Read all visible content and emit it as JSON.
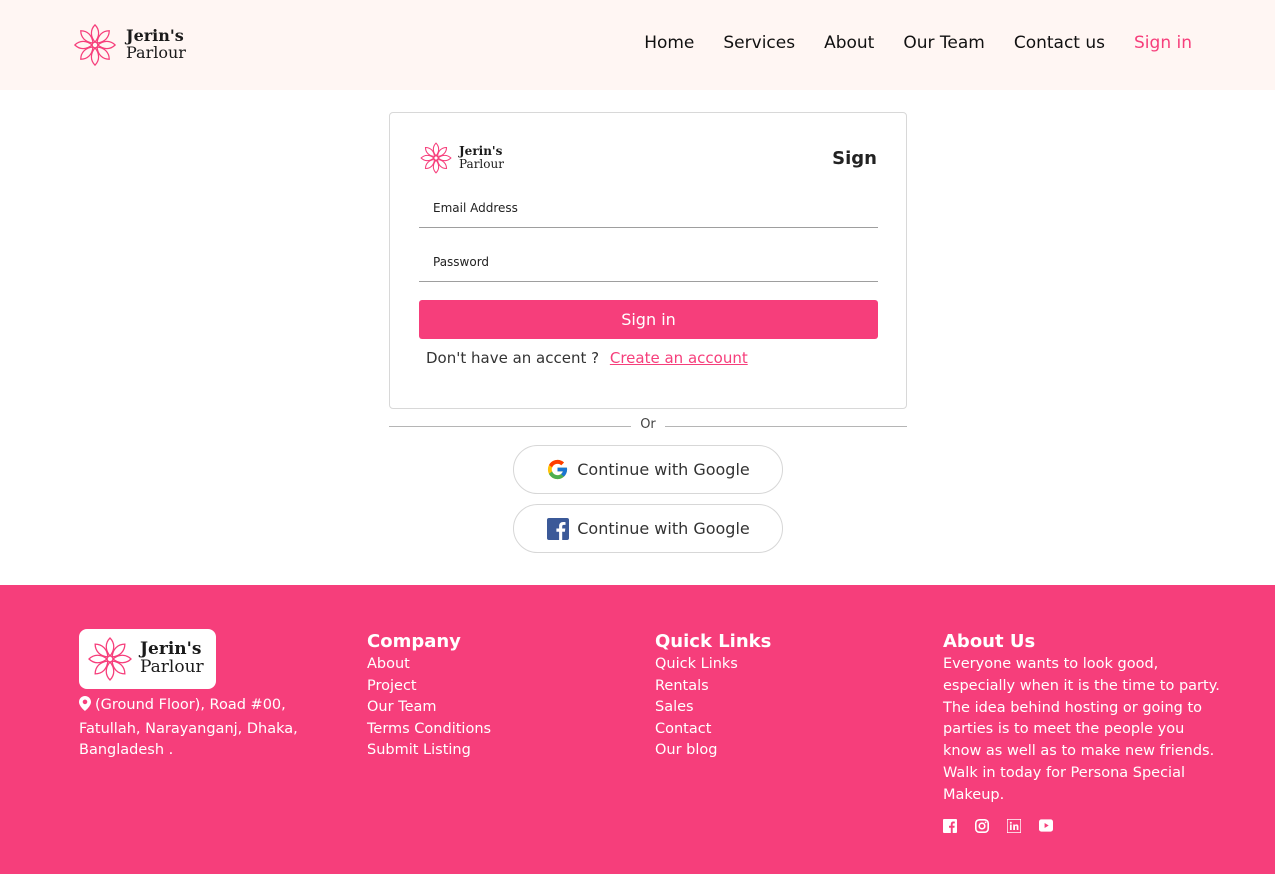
{
  "brand": {
    "name_line1": "Jerin's",
    "name_line2": "Parlour",
    "accent_color": "#f63e7b",
    "logo_icon": "lotus-flower-icon"
  },
  "nav": {
    "items": [
      {
        "label": "Home"
      },
      {
        "label": "Services"
      },
      {
        "label": "About"
      },
      {
        "label": "Our Team"
      },
      {
        "label": "Contact us"
      },
      {
        "label": "Sign in",
        "active": true
      }
    ]
  },
  "signin_card": {
    "title": "Sign",
    "email_placeholder": "Email Address",
    "password_placeholder": "Password",
    "button_label": "Sign in",
    "no_account_text": "Don't have an accent ?",
    "create_account_link": "Create an account"
  },
  "separator": {
    "label": "Or"
  },
  "social_buttons": [
    {
      "icon": "google-icon",
      "label": "Continue with Google"
    },
    {
      "icon": "facebook-icon",
      "label": "Continue with Google"
    }
  ],
  "footer": {
    "address_icon": "location-pin-icon",
    "address": "(Ground Floor), Road #00, Fatullah, Narayanganj, Dhaka, Bangladesh .",
    "company": {
      "heading": "Company",
      "links": [
        "About",
        "Project",
        "Our Team",
        "Terms Conditions",
        "Submit Listing"
      ]
    },
    "quick_links": {
      "heading": "Quick Links",
      "links": [
        "Quick Links",
        "Rentals",
        "Sales",
        "Contact",
        "Our blog"
      ]
    },
    "about_us": {
      "heading": "About Us",
      "text": "Everyone wants to look good, especially when it is the time to party. The idea behind hosting or going to parties is to meet the people you know as well as to make new friends. Walk in today for Persona Special Makeup."
    },
    "socials": [
      "facebook-icon",
      "instagram-icon",
      "linkedin-icon",
      "youtube-icon"
    ]
  }
}
